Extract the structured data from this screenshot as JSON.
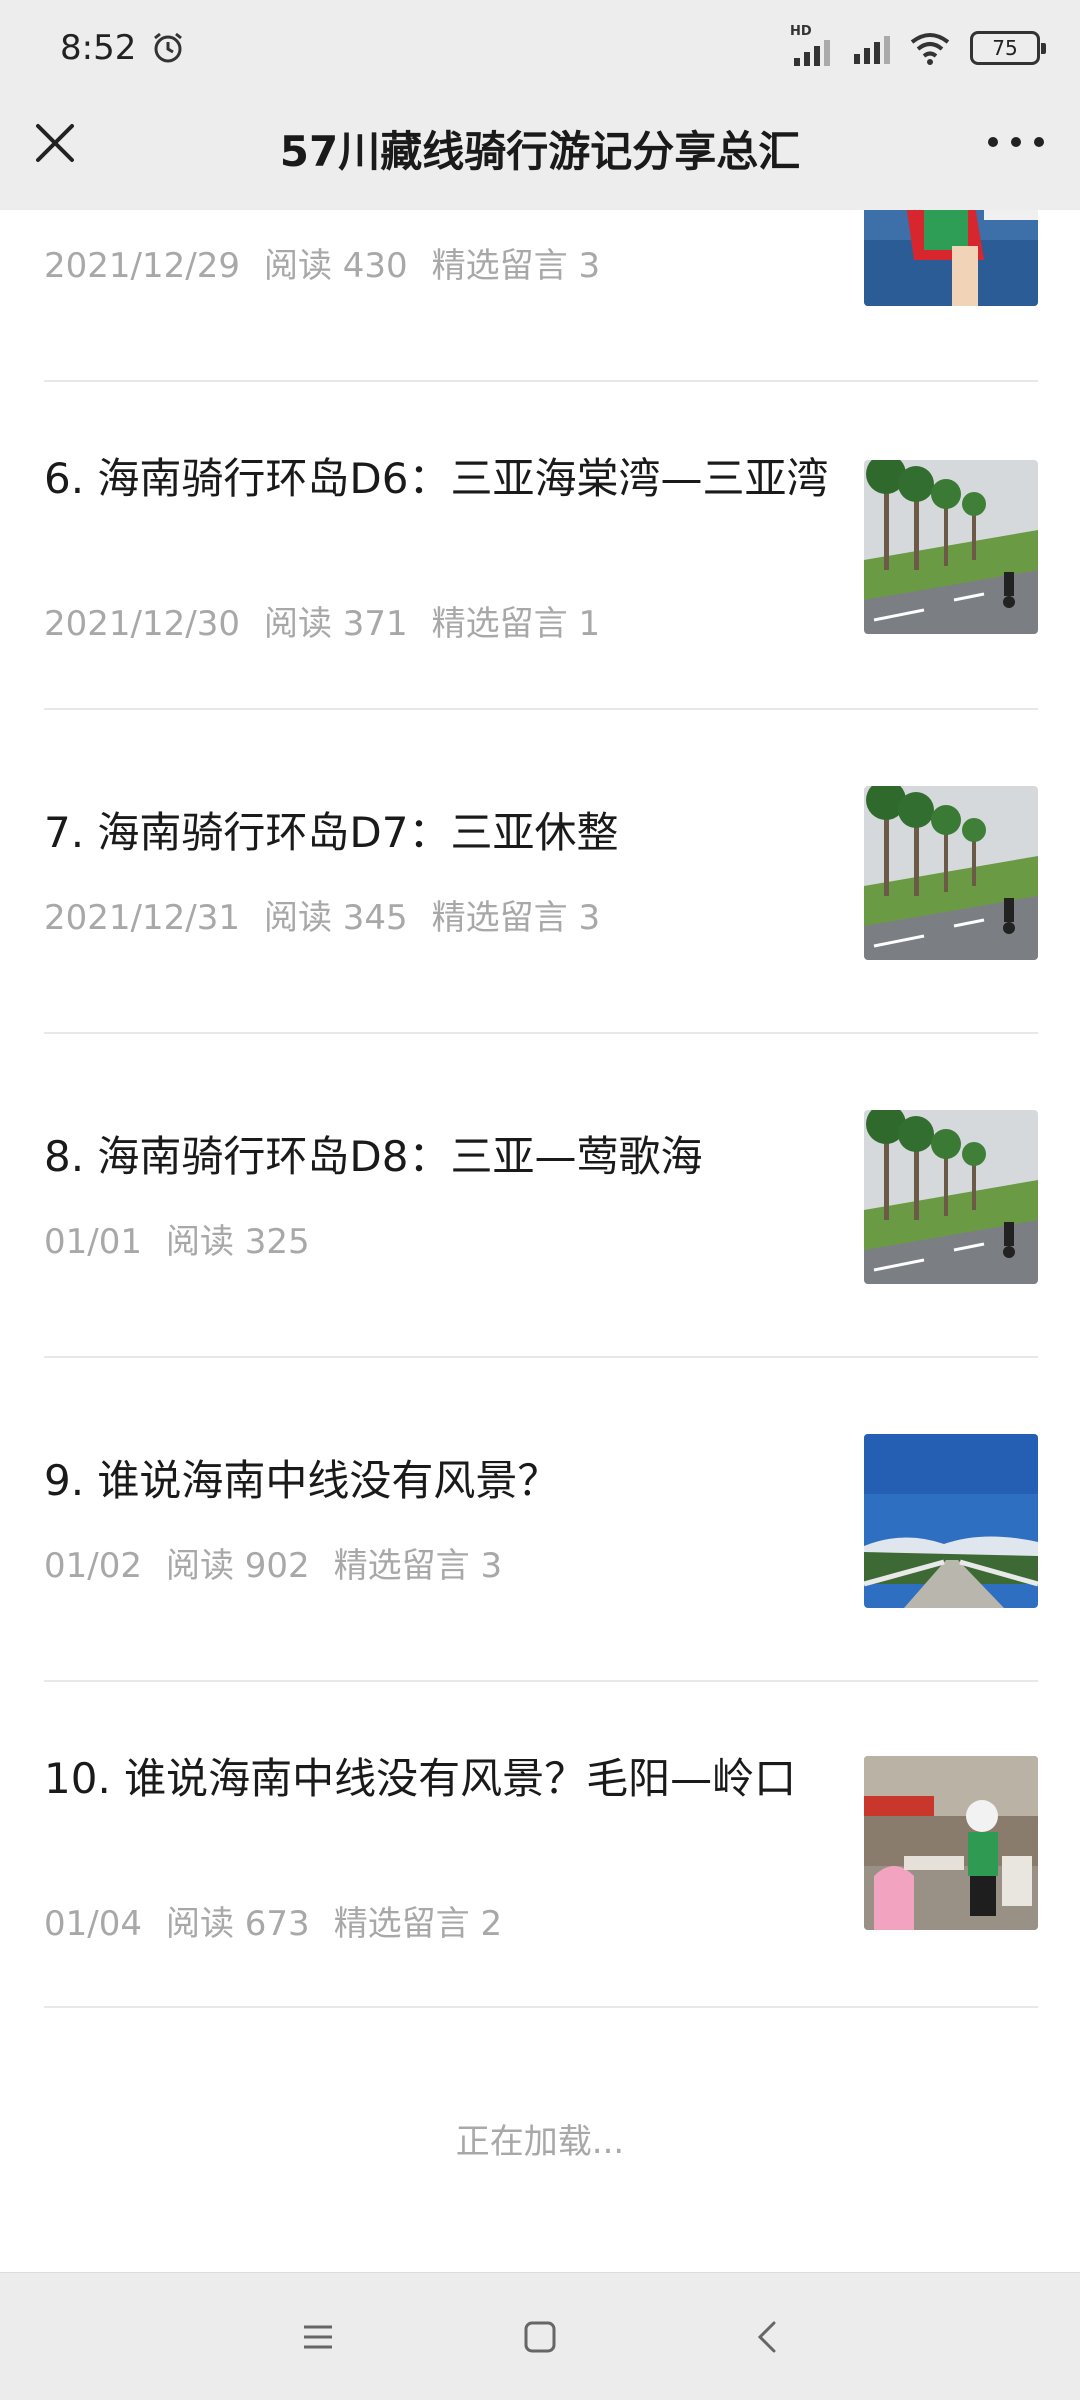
{
  "status_bar": {
    "time": "8:52",
    "hd_label": "HD",
    "battery": "75"
  },
  "header": {
    "title": "57川藏线骑行游记分享总汇"
  },
  "articles": [
    {
      "title": "",
      "date": "2021/12/29",
      "reads": "阅读 430",
      "comments": "精选留言 3",
      "thumb": "rider-boat"
    },
    {
      "title": "6. 海南骑行环岛D6：三亚海棠湾—三亚湾",
      "date": "2021/12/30",
      "reads": "阅读 371",
      "comments": "精选留言 1",
      "thumb": "palm-road"
    },
    {
      "title": "7. 海南骑行环岛D7：三亚休整",
      "date": "2021/12/31",
      "reads": "阅读 345",
      "comments": "精选留言 3",
      "thumb": "palm-road"
    },
    {
      "title": "8. 海南骑行环岛D8：三亚—莺歌海",
      "date": "01/01",
      "reads": "阅读 325",
      "comments": "",
      "thumb": "palm-road"
    },
    {
      "title": "9. 谁说海南中线没有风景？",
      "date": "01/02",
      "reads": "阅读 902",
      "comments": "精选留言 3",
      "thumb": "blue-sky-bridge"
    },
    {
      "title": "10. 谁说海南中线没有风景？毛阳—岭口",
      "date": "01/04",
      "reads": "阅读 673",
      "comments": "精选留言 2",
      "thumb": "cafe-rider"
    }
  ],
  "footer": {
    "loading_text": "正在加载..."
  },
  "icons": {
    "close": "close-icon",
    "more": "more-icon",
    "alarm": "alarm-icon",
    "menu": "menu-icon",
    "home": "home-icon",
    "back": "back-icon"
  }
}
